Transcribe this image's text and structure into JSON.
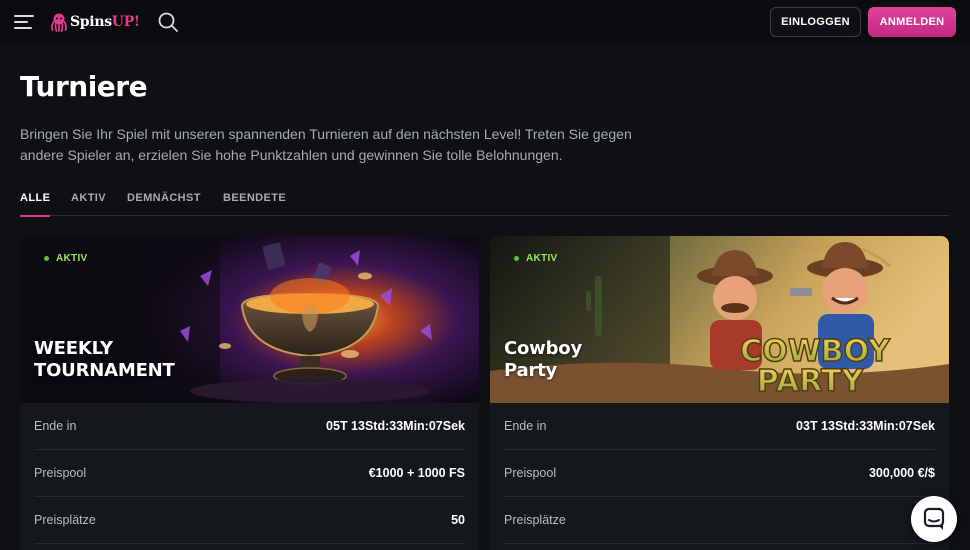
{
  "header": {
    "logo_text": "Spins",
    "logo_accent": "UP!",
    "login_label": "EINLOGGEN",
    "signup_label": "ANMELDEN"
  },
  "page": {
    "title": "Turniere",
    "intro": "Bringen Sie Ihr Spiel mit unseren spannenden Turnieren auf den nächsten Level! Treten Sie gegen andere Spieler an, erzielen Sie hohe Punktzahlen und gewinnen Sie tolle Belohnungen."
  },
  "tabs": [
    {
      "label": "ALLE",
      "active": true
    },
    {
      "label": "AKTIV",
      "active": false
    },
    {
      "label": "DEMNÄCHST",
      "active": false
    },
    {
      "label": "BEENDETE",
      "active": false
    }
  ],
  "tournaments": [
    {
      "status": "AKTIV",
      "title_line1": "WEEKLY",
      "title_line2": "TOURNAMENT",
      "rows": [
        {
          "label": "Ende in",
          "value": "05T  13Std:33Min:07Sek"
        },
        {
          "label": "Preispool",
          "value": "€1000 + 1000 FS"
        },
        {
          "label": "Preisplätze",
          "value": "50"
        }
      ]
    },
    {
      "status": "AKTIV",
      "title_line1": "Cowboy",
      "title_line2": "Party",
      "banner_logo_line1": "COWBOY",
      "banner_logo_line2": "PARTY",
      "rows": [
        {
          "label": "Ende in",
          "value": "03T  13Std:33Min:07Sek"
        },
        {
          "label": "Preispool",
          "value": "300,000 €/$"
        },
        {
          "label": "Preisplätze",
          "value": "1,"
        }
      ]
    }
  ],
  "icons": {
    "menu": "menu-icon",
    "search": "search-icon",
    "chat": "chat-icon"
  },
  "colors": {
    "accent": "#e23a8e",
    "active_status": "#9ee55b",
    "background": "#0e1013"
  }
}
